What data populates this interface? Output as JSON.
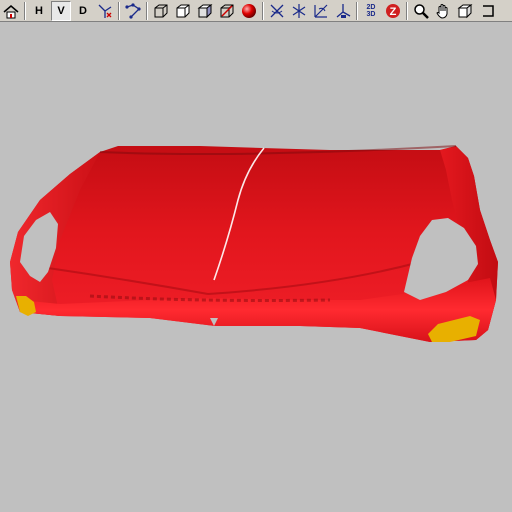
{
  "toolbar": {
    "buttons": [
      {
        "name": "home-view-icon"
      },
      {
        "name": "view-horizontal-button",
        "label": "H"
      },
      {
        "name": "view-vertical-button",
        "label": "V"
      },
      {
        "name": "view-depth-button",
        "label": "D"
      },
      {
        "name": "axis-xyz-icon"
      },
      {
        "name": "pick-points-icon"
      },
      {
        "name": "wireframe-cube-icon"
      },
      {
        "name": "hidden-line-cube-icon"
      },
      {
        "name": "shaded-cube-icon"
      },
      {
        "name": "clip-cube-icon"
      },
      {
        "name": "sphere-render-icon"
      },
      {
        "name": "rotate-x-icon"
      },
      {
        "name": "rotate-y-icon"
      },
      {
        "name": "rotate-z-icon"
      },
      {
        "name": "axis-triad-icon"
      },
      {
        "name": "toggle-2d-3d-button",
        "label_top": "2D",
        "label_bottom": "3D"
      },
      {
        "name": "zoom-z-button",
        "label": "Z"
      },
      {
        "name": "zoom-icon"
      },
      {
        "name": "pan-hand-icon"
      },
      {
        "name": "fit-cube-icon"
      },
      {
        "name": "reset-view-icon"
      }
    ]
  },
  "colors": {
    "background": "#c0c0c0",
    "body_red": "#e8111a",
    "body_dark_red": "#9e0a10",
    "lamp_amber": "#e8b000"
  }
}
